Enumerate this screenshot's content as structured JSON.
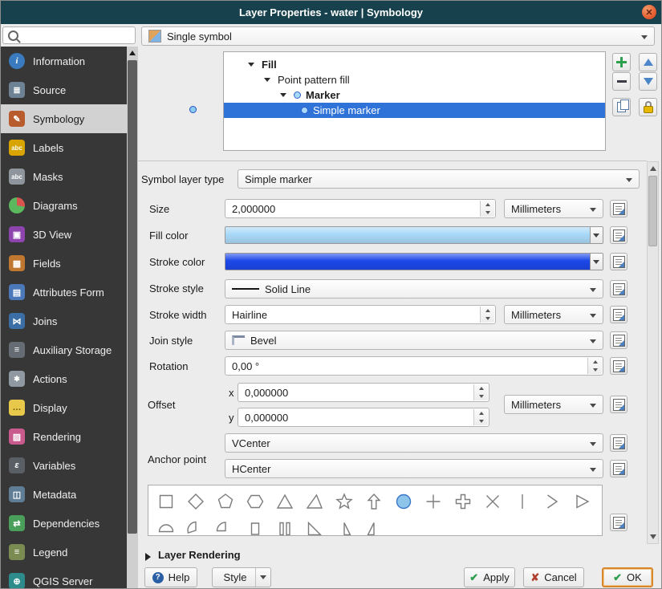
{
  "window": {
    "title": "Layer Properties - water | Symbology",
    "titlebar_color": "#17414d"
  },
  "theme": {
    "selection_color": "#2f72d8",
    "sidebar_color": "#373737"
  },
  "search": {
    "value": "",
    "placeholder": ""
  },
  "sidebar": {
    "items": [
      {
        "label": "Information",
        "selected": false
      },
      {
        "label": "Source",
        "selected": false
      },
      {
        "label": "Symbology",
        "selected": true
      },
      {
        "label": "Labels",
        "selected": false
      },
      {
        "label": "Masks",
        "selected": false
      },
      {
        "label": "Diagrams",
        "selected": false
      },
      {
        "label": "3D View",
        "selected": false
      },
      {
        "label": "Fields",
        "selected": false
      },
      {
        "label": "Attributes Form",
        "selected": false
      },
      {
        "label": "Joins",
        "selected": false
      },
      {
        "label": "Auxiliary Storage",
        "selected": false
      },
      {
        "label": "Actions",
        "selected": false
      },
      {
        "label": "Display",
        "selected": false
      },
      {
        "label": "Rendering",
        "selected": false
      },
      {
        "label": "Variables",
        "selected": false
      },
      {
        "label": "Metadata",
        "selected": false
      },
      {
        "label": "Dependencies",
        "selected": false
      },
      {
        "label": "Legend",
        "selected": false
      },
      {
        "label": "QGIS Server",
        "selected": false
      }
    ]
  },
  "renderer": {
    "value": "Single symbol"
  },
  "symbol_tree": {
    "items": [
      {
        "label": "Fill",
        "level": 0,
        "bold": true,
        "selected": false
      },
      {
        "label": "Point pattern fill",
        "level": 1,
        "bold": false,
        "selected": false
      },
      {
        "label": "Marker",
        "level": 2,
        "bold": true,
        "selected": false
      },
      {
        "label": "Simple marker",
        "level": 3,
        "bold": false,
        "selected": true
      }
    ]
  },
  "properties": {
    "symbol_layer_type": {
      "label": "Symbol layer type",
      "value": "Simple marker"
    },
    "size": {
      "label": "Size",
      "value": "2,000000",
      "unit": "Millimeters"
    },
    "fill_color": {
      "label": "Fill color",
      "color": "#a9d9f8"
    },
    "stroke_color": {
      "label": "Stroke color",
      "color": "#1c47e8"
    },
    "stroke_style": {
      "label": "Stroke style",
      "value": "Solid Line"
    },
    "stroke_width": {
      "label": "Stroke width",
      "value": "Hairline",
      "unit": "Millimeters"
    },
    "join_style": {
      "label": "Join style",
      "value": "Bevel"
    },
    "rotation": {
      "label": "Rotation",
      "value": "0,00 °"
    },
    "offset": {
      "label": "Offset",
      "x_label": "x",
      "x_value": "0,000000",
      "y_label": "y",
      "y_value": "0,000000",
      "unit": "Millimeters"
    },
    "vertical_anchor": {
      "value": "VCenter"
    },
    "anchor_point": {
      "label": "Anchor point",
      "value": "HCenter"
    }
  },
  "shapes": [
    "square",
    "diamond",
    "pentagon",
    "hexagon",
    "triangle",
    "equilateral-triangle",
    "star",
    "arrow",
    "circle",
    "cross",
    "cross-fill",
    "cross2",
    "line",
    "arrowhead",
    "filled-arrowhead",
    "semi-circle",
    "third-circle",
    "quarter-circle",
    "quarter-square",
    "half-square",
    "diagonal-half-square",
    "right-half-triangle",
    "left-half-triangle"
  ],
  "layer_rendering": {
    "label": "Layer Rendering"
  },
  "footer": {
    "help": "Help",
    "style": "Style",
    "apply": "Apply",
    "cancel": "Cancel",
    "ok": "OK"
  }
}
